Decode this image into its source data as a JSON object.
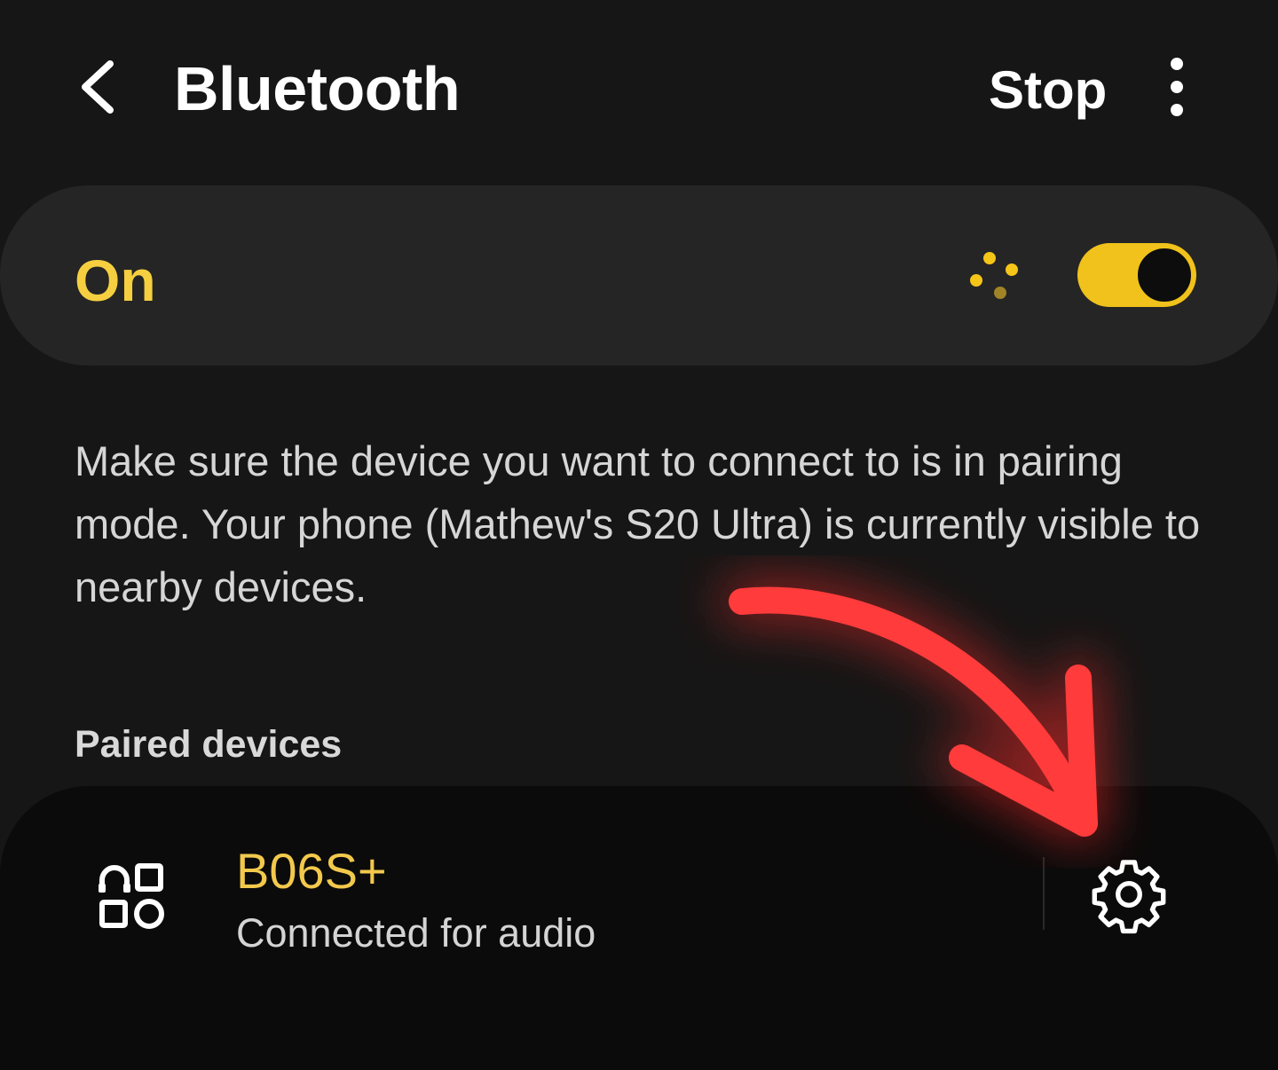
{
  "header": {
    "back_icon": "chevron-left-icon",
    "title": "Bluetooth",
    "stop_label": "Stop",
    "more_icon": "more-vert-icon"
  },
  "master_switch": {
    "label": "On",
    "state": true,
    "scan_icon": "scanning-dots-icon",
    "accent_color": "#f5c518"
  },
  "description": "Make sure the device you want to connect to is in pairing mode. Your phone (Mathew's S20 Ultra) is currently visible to nearby devices.",
  "paired_devices": {
    "header": "Paired devices",
    "items": [
      {
        "icon": "device-type-other-icon",
        "name": "B06S+",
        "status": "Connected for audio",
        "settings_icon": "gear-icon"
      }
    ]
  },
  "annotation": {
    "type": "red-arrow",
    "color": "#ff3333",
    "points_to": "device-settings-button"
  }
}
